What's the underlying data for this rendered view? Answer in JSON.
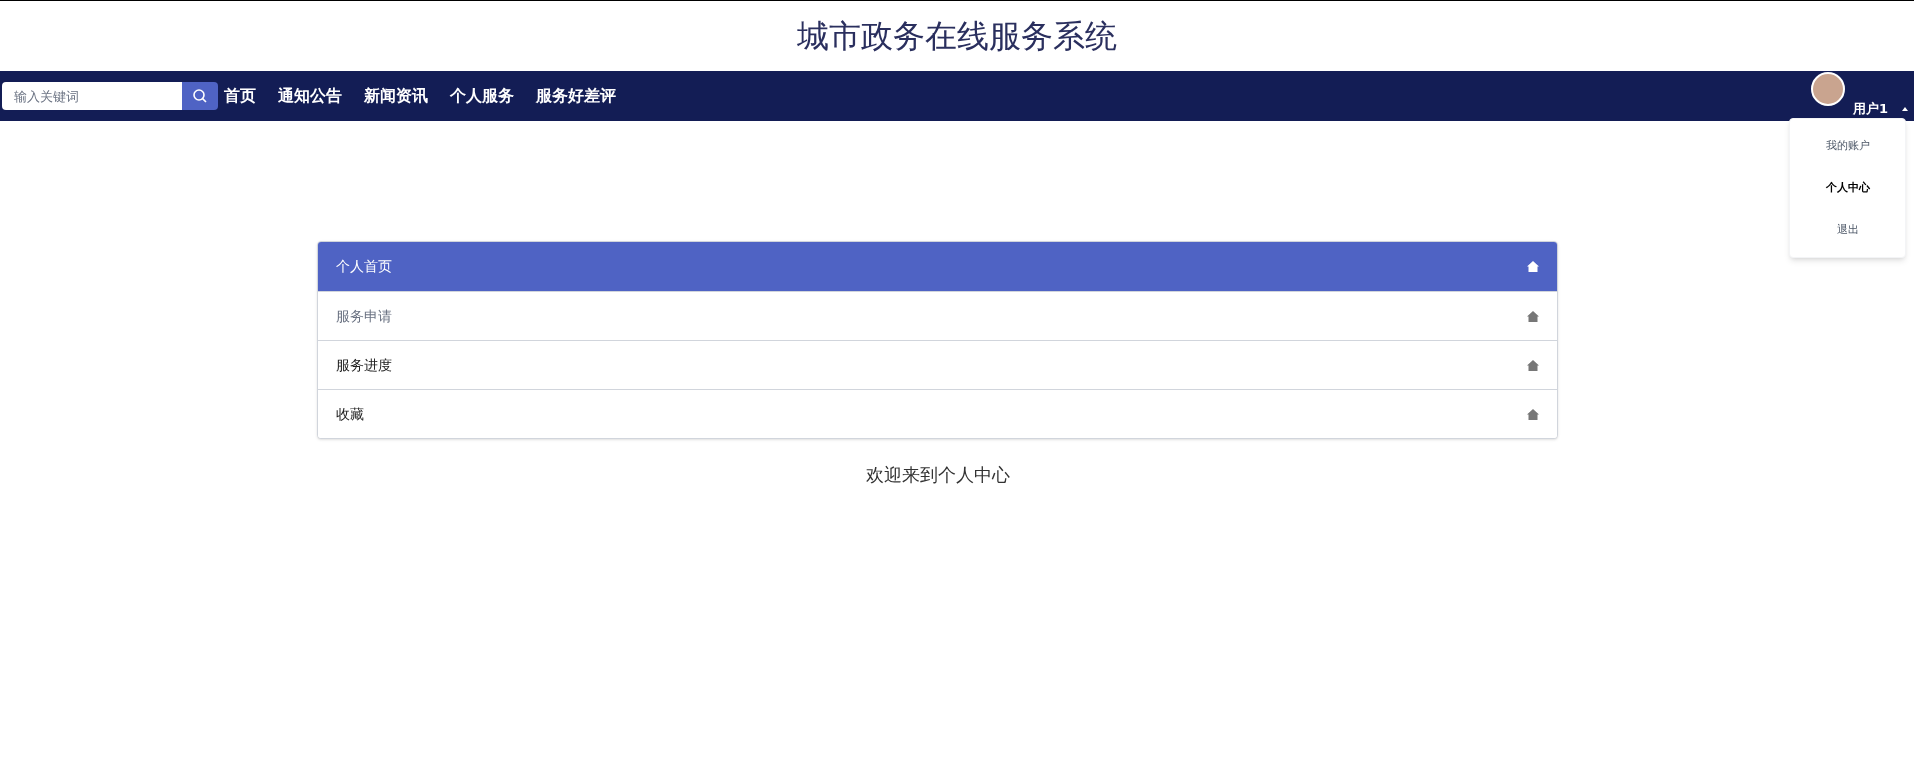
{
  "header": {
    "title": "城市政务在线服务系统"
  },
  "navbar": {
    "search": {
      "placeholder": "输入关键词"
    },
    "links": [
      {
        "label": "首页"
      },
      {
        "label": "通知公告"
      },
      {
        "label": "新闻资讯"
      },
      {
        "label": "个人服务"
      },
      {
        "label": "服务好差评"
      }
    ],
    "user": {
      "name": "用户1",
      "menu_open": true,
      "menu": [
        {
          "label": "我的账户",
          "selected": false
        },
        {
          "label": "个人中心",
          "selected": true
        },
        {
          "label": "退出",
          "selected": false
        }
      ]
    }
  },
  "side_menu": [
    {
      "label": "个人首页",
      "selected": true,
      "hovered": false
    },
    {
      "label": "服务申请",
      "selected": false,
      "hovered": true
    },
    {
      "label": "服务进度",
      "selected": false,
      "hovered": false
    },
    {
      "label": "收藏",
      "selected": false,
      "hovered": false
    }
  ],
  "welcome": "欢迎来到个人中心"
}
